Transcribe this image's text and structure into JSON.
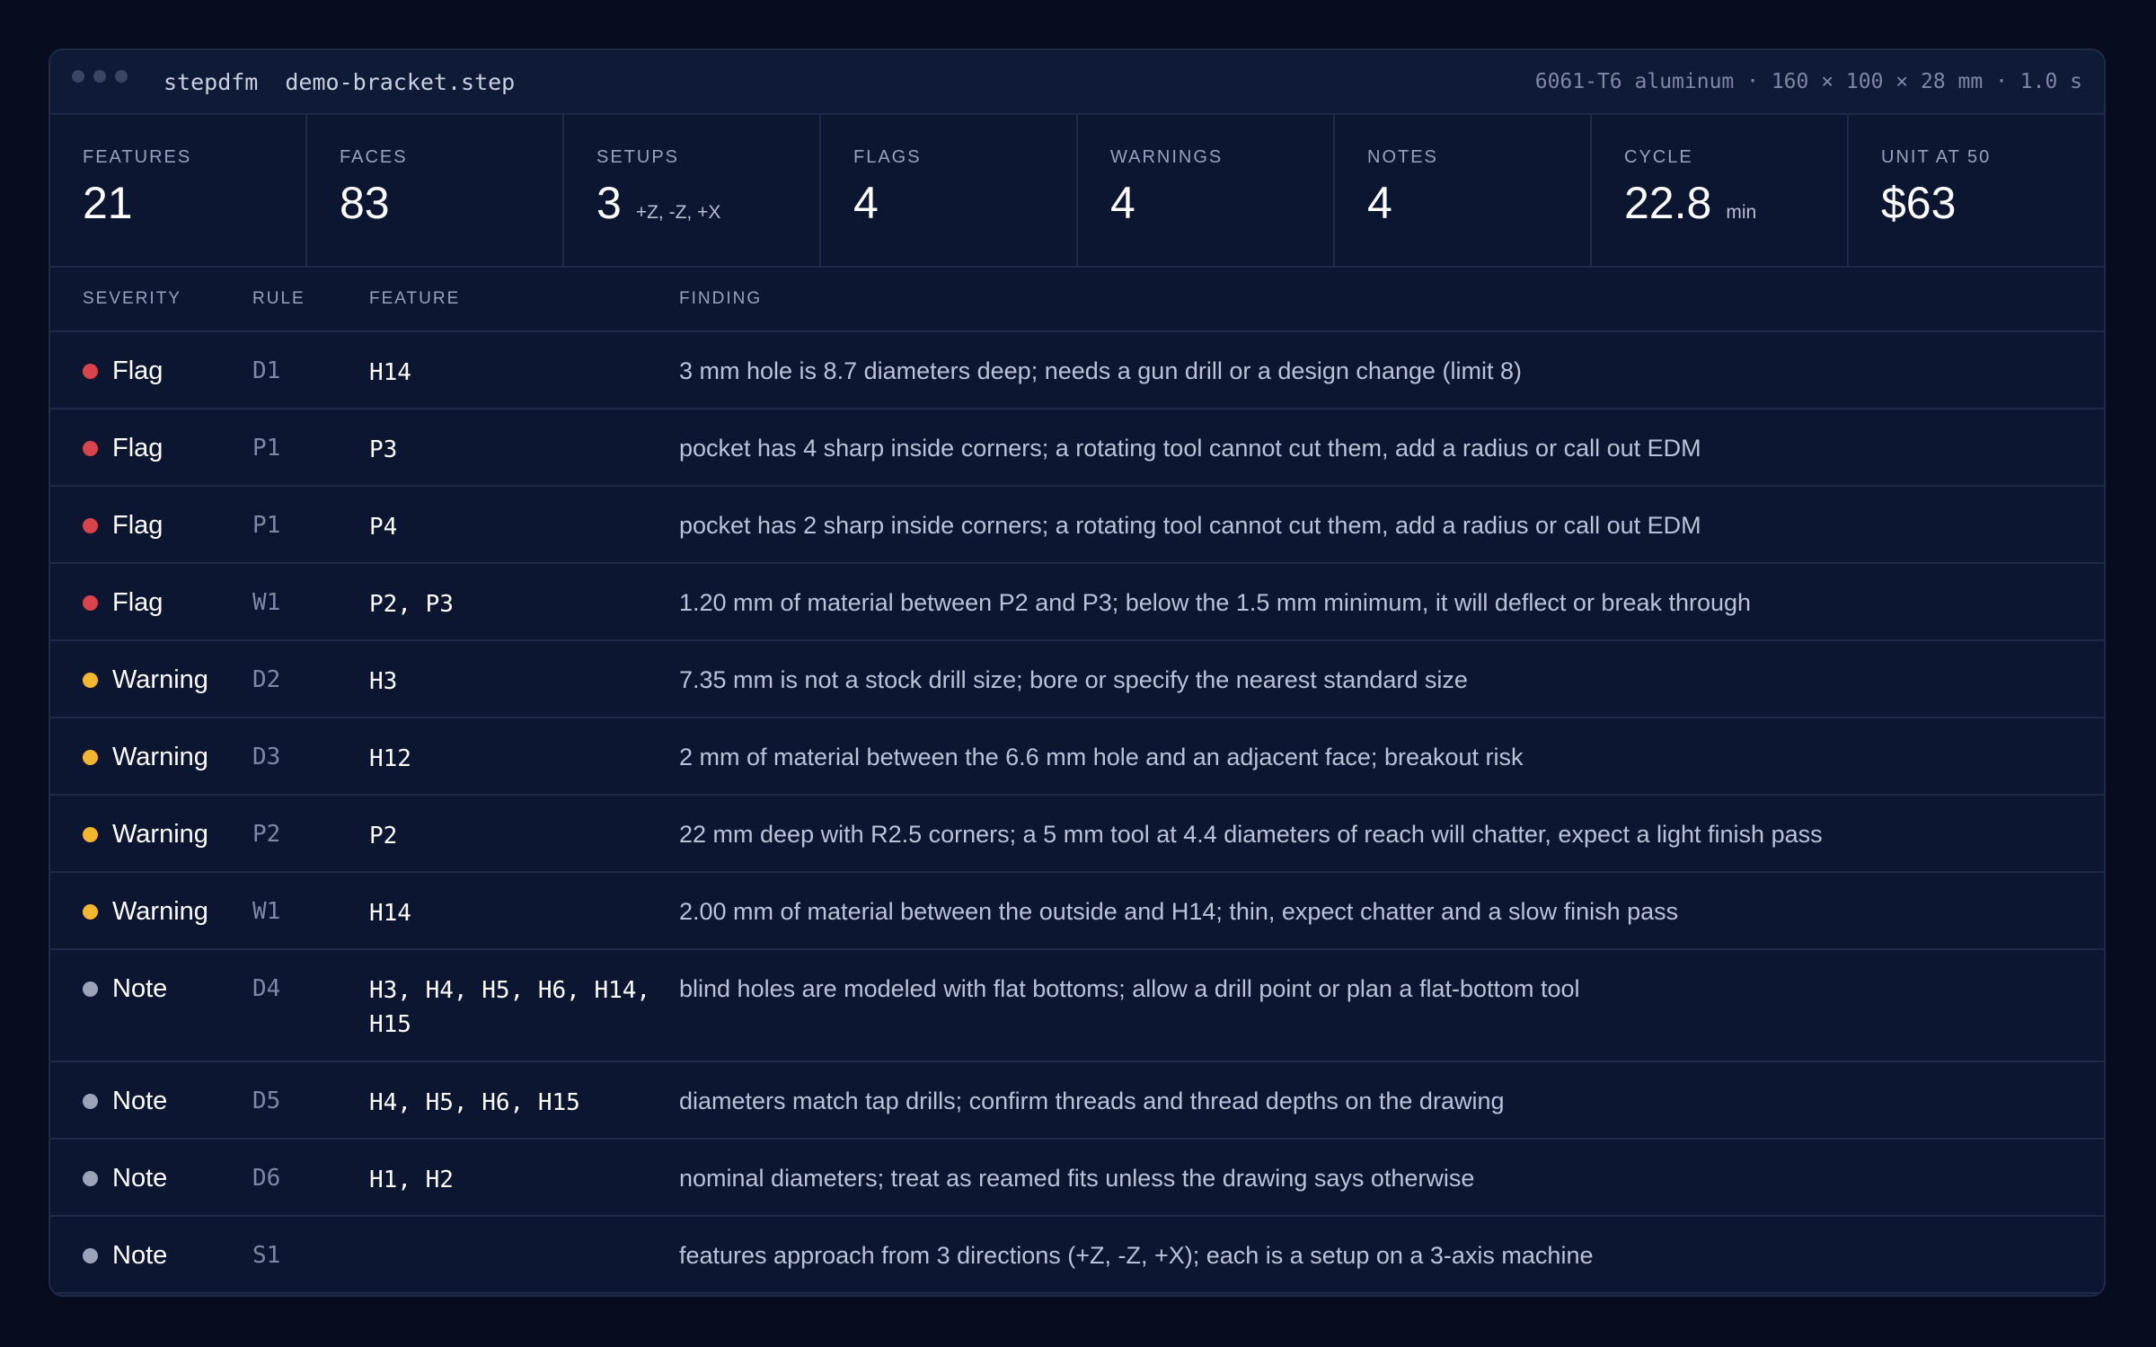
{
  "window": {
    "app_name": "stepdfm",
    "file_name": "demo-bracket.step",
    "meta": "6061-T6 aluminum · 160 × 100 × 28 mm · 1.0 s"
  },
  "stats": [
    {
      "label": "FEATURES",
      "value": "21",
      "sub": ""
    },
    {
      "label": "FACES",
      "value": "83",
      "sub": ""
    },
    {
      "label": "SETUPS",
      "value": "3",
      "sub": "+Z, -Z, +X"
    },
    {
      "label": "FLAGS",
      "value": "4",
      "sub": ""
    },
    {
      "label": "WARNINGS",
      "value": "4",
      "sub": ""
    },
    {
      "label": "NOTES",
      "value": "4",
      "sub": ""
    },
    {
      "label": "CYCLE",
      "value": "22.8",
      "sub": "min"
    },
    {
      "label": "UNIT AT 50",
      "value": "$63",
      "sub": ""
    }
  ],
  "table": {
    "headers": {
      "severity": "SEVERITY",
      "rule": "RULE",
      "feature": "FEATURE",
      "finding": "FINDING"
    },
    "severity_colors": {
      "Flag": "#d9434b",
      "Warning": "#f3b62f",
      "Note": "#9aa3ba"
    },
    "rows": [
      {
        "severity": "Flag",
        "rule": "D1",
        "feature": "H14",
        "finding": "3 mm hole is 8.7 diameters deep; needs a gun drill or a design change (limit 8)"
      },
      {
        "severity": "Flag",
        "rule": "P1",
        "feature": "P3",
        "finding": "pocket has 4 sharp inside corners; a rotating tool cannot cut them, add a radius or call out EDM"
      },
      {
        "severity": "Flag",
        "rule": "P1",
        "feature": "P4",
        "finding": "pocket has 2 sharp inside corners; a rotating tool cannot cut them, add a radius or call out EDM"
      },
      {
        "severity": "Flag",
        "rule": "W1",
        "feature": "P2, P3",
        "finding": "1.20 mm of material between P2 and P3; below the 1.5 mm minimum, it will deflect or break through"
      },
      {
        "severity": "Warning",
        "rule": "D2",
        "feature": "H3",
        "finding": "7.35 mm is not a stock drill size; bore or specify the nearest standard size"
      },
      {
        "severity": "Warning",
        "rule": "D3",
        "feature": "H12",
        "finding": "2 mm of material between the 6.6 mm hole and an adjacent face; breakout risk"
      },
      {
        "severity": "Warning",
        "rule": "P2",
        "feature": "P2",
        "finding": "22 mm deep with R2.5 corners; a 5 mm tool at 4.4 diameters of reach will chatter, expect a light finish pass"
      },
      {
        "severity": "Warning",
        "rule": "W1",
        "feature": "H14",
        "finding": "2.00 mm of material between the outside and H14; thin, expect chatter and a slow finish pass"
      },
      {
        "severity": "Note",
        "rule": "D4",
        "feature": "H3, H4, H5, H6, H14, H15",
        "finding": "blind holes are modeled with flat bottoms; allow a drill point or plan a flat-bottom tool"
      },
      {
        "severity": "Note",
        "rule": "D5",
        "feature": "H4, H5, H6, H15",
        "finding": "diameters match tap drills; confirm threads and thread depths on the drawing"
      },
      {
        "severity": "Note",
        "rule": "D6",
        "feature": "H1, H2",
        "finding": "nominal diameters; treat as reamed fits unless the drawing says otherwise"
      },
      {
        "severity": "Note",
        "rule": "S1",
        "feature": "",
        "finding": "features approach from 3 directions (+Z, -Z, +X); each is a setup on a 3-axis machine"
      }
    ]
  }
}
